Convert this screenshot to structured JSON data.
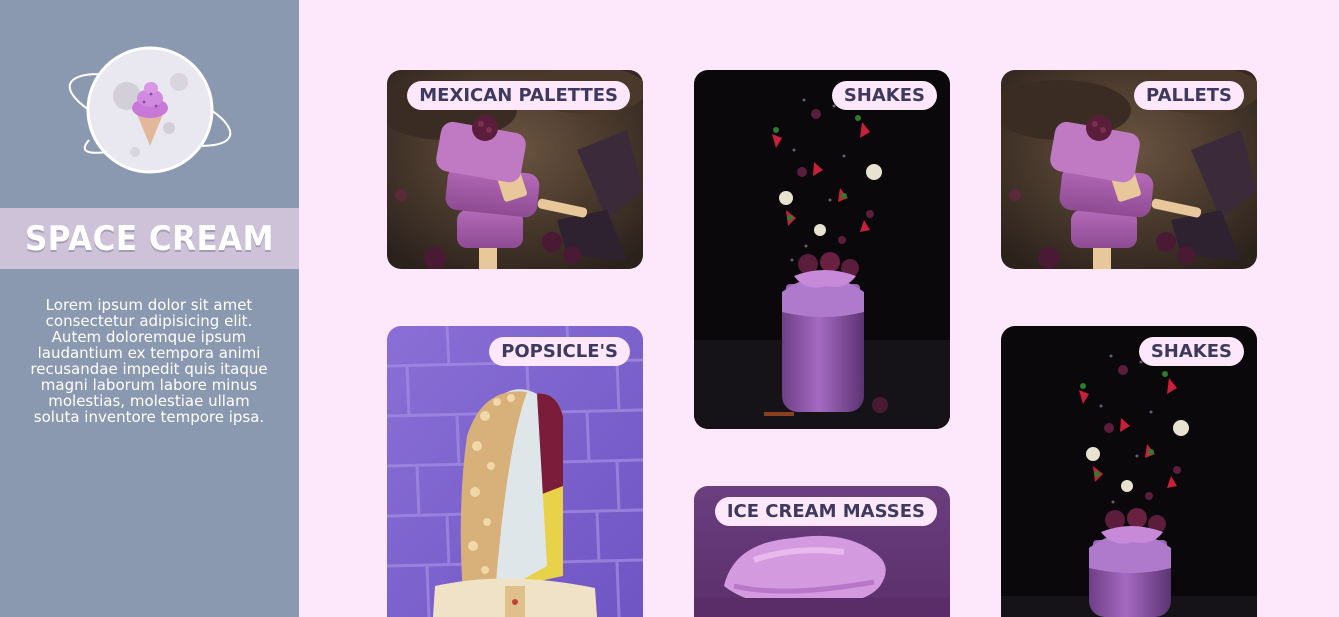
{
  "brand": {
    "name": "SPACE CREAM",
    "description": "Lorem ipsum dolor sit amet consectetur adipisicing elit. Autem doloremque ipsum laudantium ex tempora animi recusandae impedit quis itaque magni laborum labore minus molestias, molestiae ullam soluta inventore tempore ipsa."
  },
  "gallery": {
    "cards": [
      {
        "label": "MEXICAN PALETTES",
        "image": "purple-popsicles-photo"
      },
      {
        "label": "SHAKES",
        "image": "berry-shake-photo"
      },
      {
        "label": "PALLETS",
        "image": "purple-popsicles-photo"
      },
      {
        "label": "POPSICLE'S",
        "image": "nut-popsicle-photo"
      },
      {
        "label": "ICE CREAM MASSES",
        "image": "ice-cream-scoop-photo"
      },
      {
        "label": "SHAKES",
        "image": "berry-shake-photo"
      }
    ]
  },
  "colors": {
    "sidebar": "#8a98b0",
    "page_background": "#fde8fb",
    "brand_band": "#cec2d9",
    "label_pill": "#fde8fb",
    "label_text": "#3e3a5e"
  }
}
